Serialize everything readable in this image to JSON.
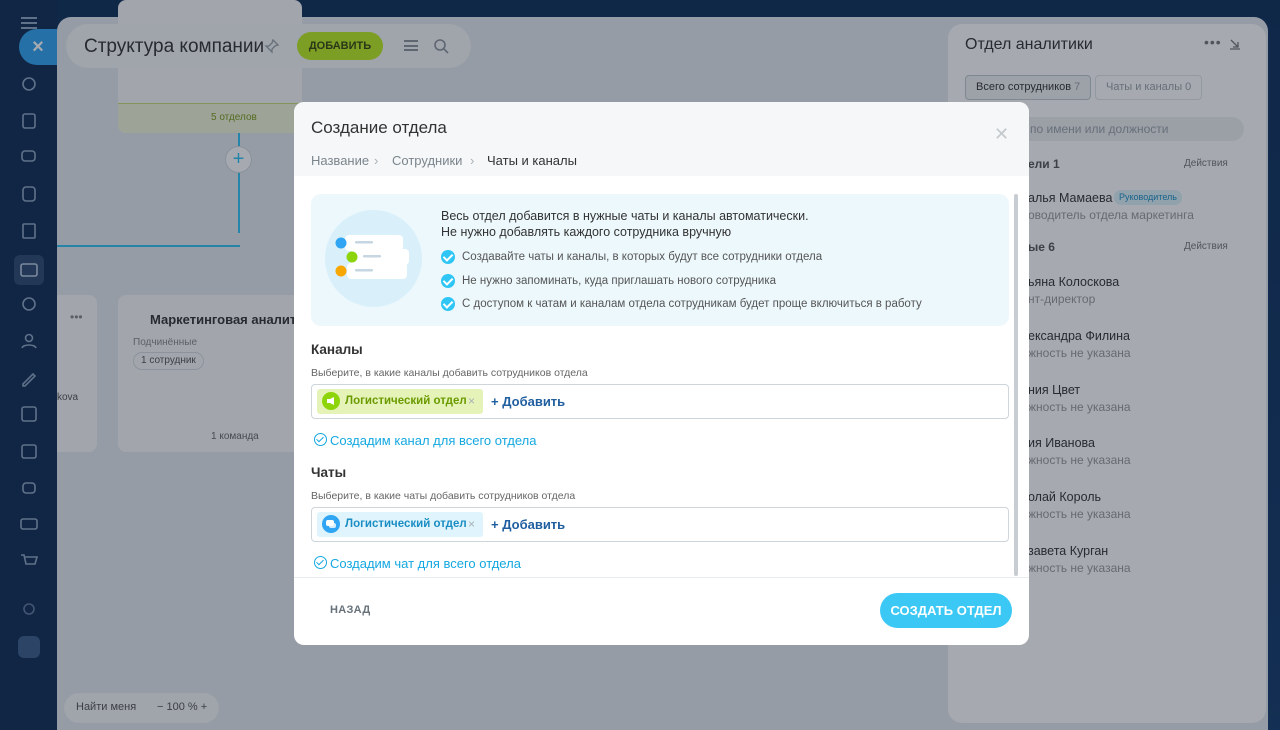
{
  "header": {
    "title": "Структура компании",
    "add_label": "ДОБАВИТЬ"
  },
  "canvas": {
    "card1_band": "5 отделов",
    "card2": {
      "title": "Маркетинговая аналитик",
      "sub": "Подчинённые",
      "chip": "1 сотрудник",
      "foot": "1 команда"
    },
    "card3_text": "kova"
  },
  "bottom": {
    "find_me": "Найти меня",
    "zoom": "− 100 % +"
  },
  "right_panel": {
    "title": "Отдел аналитики",
    "tabs": [
      {
        "label": "Всего сотрудников",
        "count": "7"
      },
      {
        "label": "Чаты и каналы",
        "count": "0"
      }
    ],
    "search_placeholder": "по имени или должности",
    "sections": [
      {
        "label": "ели 1",
        "action": "Действия"
      },
      {
        "label": "ые 6",
        "action": "Действия"
      }
    ],
    "head_badge": "Руководитель",
    "people": [
      {
        "name": "алья Мамаева",
        "role": "оводитель отдела маркетинга"
      },
      {
        "name": "ьяна Колоскова",
        "role": "нт-директор"
      },
      {
        "name": "ександра Филина",
        "role": "жность не указана"
      },
      {
        "name": "ния Цвет",
        "role": "жность не указана"
      },
      {
        "name": "ия Иванова",
        "role": "жность не указана"
      },
      {
        "name": "олай Король",
        "role": "жность не указана"
      },
      {
        "name": "завета Курган",
        "role": "жность не указана"
      }
    ]
  },
  "modal": {
    "title": "Создание отдела",
    "breadcrumbs": [
      "Название",
      "Сотрудники",
      "Чаты и каналы"
    ],
    "info": {
      "heading": "Весь отдел добавится в нужные чаты и каналы автоматически.",
      "heading2": "Не нужно добавлять каждого сотрудника вручную",
      "items": [
        "Создавайте чаты и каналы, в которых будут все сотрудники отдела",
        "Не нужно запоминать, куда приглашать нового сотрудника",
        "С доступом к чатам и каналам отдела сотрудникам будет проще включиться в работу"
      ]
    },
    "channels": {
      "heading": "Каналы",
      "hint": "Выберите, в какие каналы добавить сотрудников отдела",
      "chip": "Логистический отдел",
      "add": "+ Добавить",
      "create": "Создадим канал для всего отдела"
    },
    "chats": {
      "heading": "Чаты",
      "hint": "Выберите, в какие чаты добавить сотрудников отдела",
      "chip": "Логистический отдел",
      "add": "+ Добавить",
      "create": "Создадим чат для всего отдела"
    },
    "back": "НАЗАД",
    "submit": "СОЗДАТЬ ОТДЕЛ"
  },
  "colors": {
    "accent": "#3bc8f5",
    "add_green": "#bbed21",
    "link": "#1f5e9f"
  }
}
